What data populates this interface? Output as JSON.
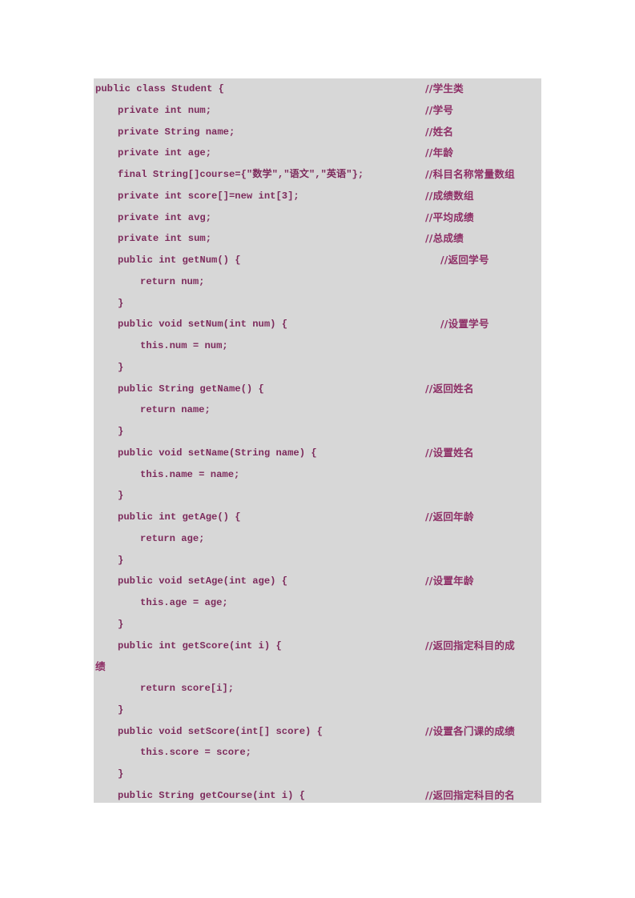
{
  "document": {
    "type": "code-listing",
    "language": "Java",
    "background_color": "#ffffff",
    "code_block_color": "#d7d7d7",
    "code_text_color": "#7d2b5c",
    "comment_text_color": "#8e2f66"
  },
  "code": {
    "lines": [
      {
        "indent": 0,
        "text": "public class Student {",
        "comment": "//学生类",
        "comment_col": "a"
      },
      {
        "indent": 1,
        "text": "private int num;",
        "comment": "//学号",
        "comment_col": "a"
      },
      {
        "indent": 1,
        "text": "private String name;",
        "comment": "//姓名",
        "comment_col": "a"
      },
      {
        "indent": 1,
        "text": "private int age;",
        "comment": "//年龄",
        "comment_col": "a"
      },
      {
        "indent": 1,
        "text": "final String[]course={\"数学\",\"语文\",\"英语\"};",
        "comment": "//科目名称常量数组",
        "comment_col": "a"
      },
      {
        "indent": 1,
        "text": "private int score[]=new int[3];",
        "comment": "//成绩数组",
        "comment_col": "a"
      },
      {
        "indent": 1,
        "text": "private int avg;",
        "comment": "//平均成绩",
        "comment_col": "a"
      },
      {
        "indent": 1,
        "text": "private int sum;",
        "comment": "//总成绩",
        "comment_col": "a"
      },
      {
        "indent": 1,
        "text": "public int getNum() {",
        "comment": "//返回学号",
        "comment_col": "b"
      },
      {
        "indent": 2,
        "text": "return num;",
        "comment": "",
        "comment_col": "a"
      },
      {
        "indent": 1,
        "text": "}",
        "comment": "",
        "comment_col": "a"
      },
      {
        "indent": 1,
        "text": "public void setNum(int num) {",
        "comment": "//设置学号",
        "comment_col": "b"
      },
      {
        "indent": 2,
        "text": "this.num = num;",
        "comment": "",
        "comment_col": "a"
      },
      {
        "indent": 1,
        "text": "}",
        "comment": "",
        "comment_col": "a"
      },
      {
        "indent": 1,
        "text": "public String getName() {",
        "comment": "//返回姓名",
        "comment_col": "a"
      },
      {
        "indent": 2,
        "text": "return name;",
        "comment": "",
        "comment_col": "a"
      },
      {
        "indent": 1,
        "text": "}",
        "comment": "",
        "comment_col": "a"
      },
      {
        "indent": 1,
        "text": "public void setName(String name) {",
        "comment": "//设置姓名",
        "comment_col": "a"
      },
      {
        "indent": 2,
        "text": "this.name = name;",
        "comment": "",
        "comment_col": "a"
      },
      {
        "indent": 1,
        "text": "}",
        "comment": "",
        "comment_col": "a"
      },
      {
        "indent": 1,
        "text": "public int getAge() {",
        "comment": "//返回年龄",
        "comment_col": "a"
      },
      {
        "indent": 2,
        "text": "return age;",
        "comment": "",
        "comment_col": "a"
      },
      {
        "indent": 1,
        "text": "}",
        "comment": "",
        "comment_col": "a"
      },
      {
        "indent": 1,
        "text": "public void setAge(int age) {",
        "comment": "//设置年龄",
        "comment_col": "a"
      },
      {
        "indent": 2,
        "text": "this.age = age;",
        "comment": "",
        "comment_col": "a"
      },
      {
        "indent": 1,
        "text": "}",
        "comment": "",
        "comment_col": "a"
      },
      {
        "indent": 1,
        "text": "public int getScore(int i) {",
        "comment": "//返回指定科目的成",
        "comment_col": "a",
        "wrap_tail": "绩"
      },
      {
        "indent": 2,
        "text": "return score[i];",
        "comment": "",
        "comment_col": "a"
      },
      {
        "indent": 1,
        "text": "}",
        "comment": "",
        "comment_col": "a"
      },
      {
        "indent": 1,
        "text": "public void setScore(int[] score) {",
        "comment": "//设置各门课的成绩",
        "comment_col": "a"
      },
      {
        "indent": 2,
        "text": "this.score = score;",
        "comment": "",
        "comment_col": "a"
      },
      {
        "indent": 1,
        "text": "}",
        "comment": "",
        "comment_col": "a"
      },
      {
        "indent": 1,
        "text": "public String getCourse(int i) {",
        "comment": "//返回指定科目的名",
        "comment_col": "a"
      }
    ]
  }
}
